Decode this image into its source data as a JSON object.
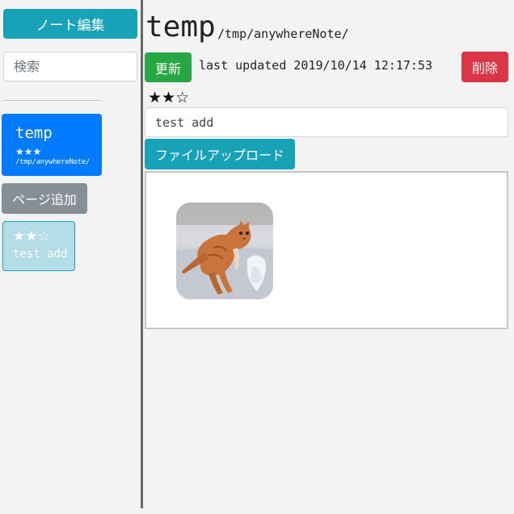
{
  "sidebar": {
    "edit_button": "ノート編集",
    "search_placeholder": "検索",
    "pages": [
      {
        "title": "temp",
        "stars": "★★★",
        "path": "/tmp/anywhereNote/"
      }
    ],
    "add_page_button": "ページ追加",
    "notes": [
      {
        "stars": "★★☆",
        "text": "test add"
      }
    ]
  },
  "main": {
    "title": "temp",
    "path": "/tmp/anywhereNote/",
    "update_button": "更新",
    "last_updated": "last updated 2019/10/14 12:17:53",
    "delete_button": "削除",
    "rating": "★★☆",
    "note_input_value": "test add",
    "upload_button": "ファイルアップロード",
    "files": [
      {
        "type": "image",
        "subject": "orange cat jumping in snow"
      }
    ]
  },
  "colors": {
    "primary": "#007bff",
    "info": "#17a2b8",
    "success": "#28a745",
    "danger": "#dc3545",
    "secondary": "#868e96",
    "note_card": "#b3dde7"
  }
}
